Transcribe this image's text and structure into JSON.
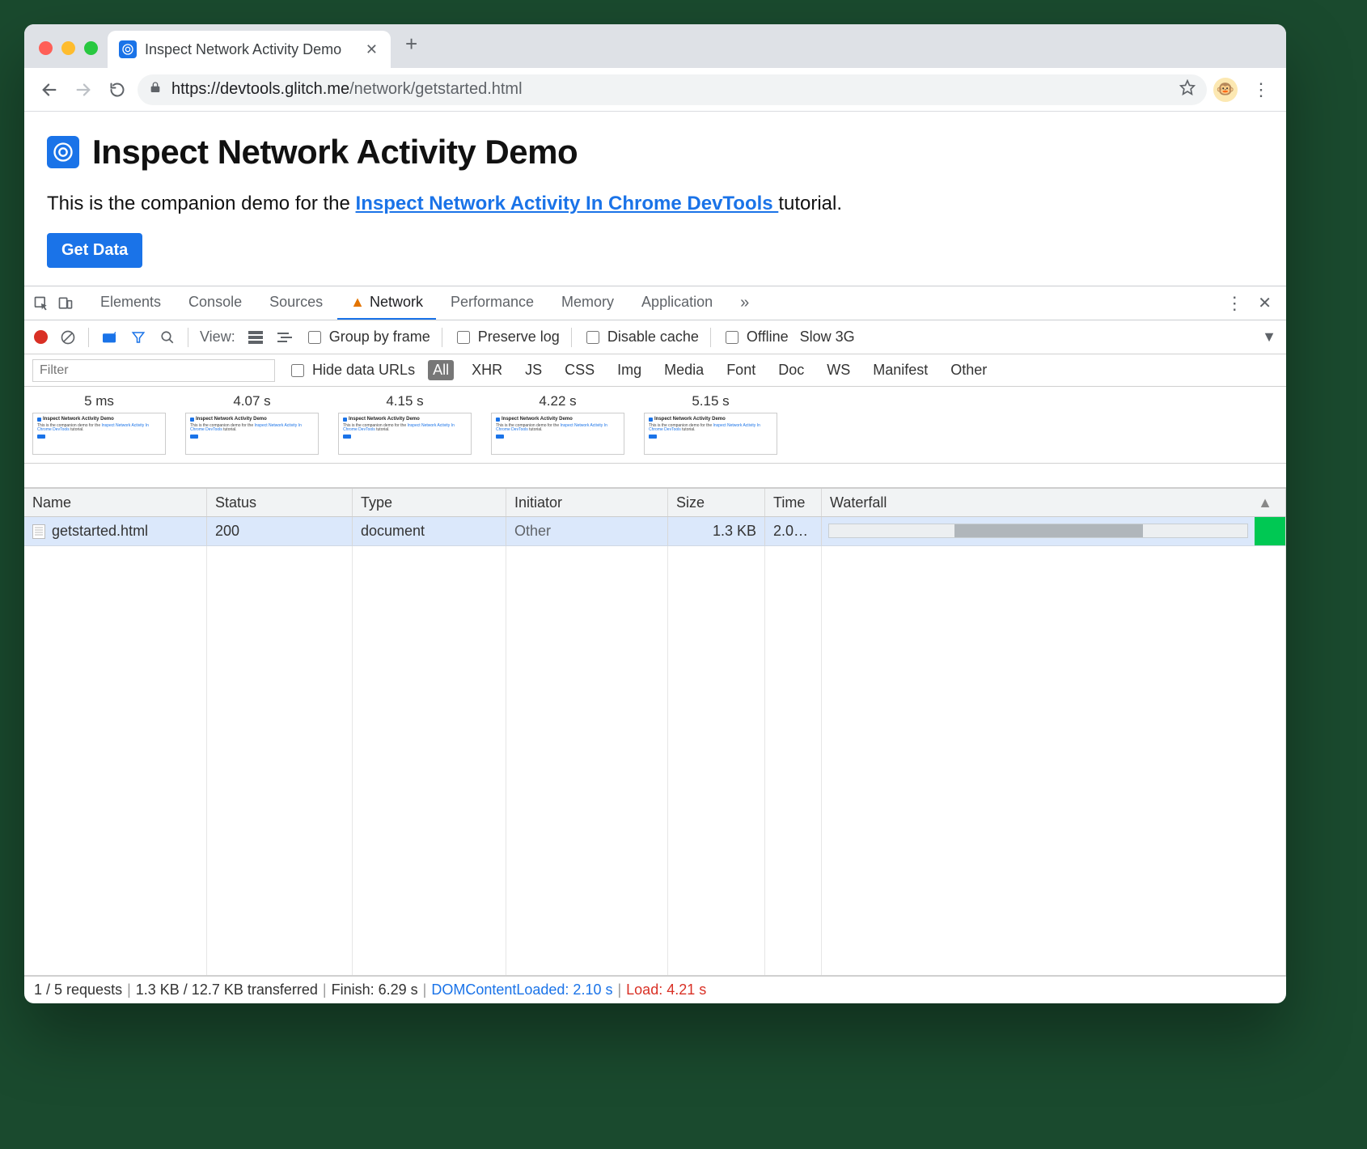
{
  "browser": {
    "tab_title": "Inspect Network Activity Demo",
    "url_display_host": "https://devtools.glitch.me",
    "url_display_path": "/network/getstarted.html"
  },
  "page": {
    "heading": "Inspect Network Activity Demo",
    "intro_before": "This is the companion demo for the ",
    "intro_link": "Inspect Network Activity In Chrome DevTools ",
    "intro_after": "tutorial.",
    "button_label": "Get Data"
  },
  "devtools": {
    "tabs": {
      "elements": "Elements",
      "console": "Console",
      "sources": "Sources",
      "network": "Network",
      "performance": "Performance",
      "memory": "Memory",
      "application": "Application"
    },
    "toolbar": {
      "view_label": "View:",
      "group_by_frame": "Group by frame",
      "preserve_log": "Preserve log",
      "disable_cache": "Disable cache",
      "offline": "Offline",
      "throttle": "Slow 3G"
    },
    "filterbar": {
      "placeholder": "Filter",
      "hide_data_urls": "Hide data URLs",
      "types": [
        "All",
        "XHR",
        "JS",
        "CSS",
        "Img",
        "Media",
        "Font",
        "Doc",
        "WS",
        "Manifest",
        "Other"
      ],
      "active_type": "All"
    },
    "filmstrip": [
      {
        "time": "5 ms"
      },
      {
        "time": "4.07 s"
      },
      {
        "time": "4.15 s"
      },
      {
        "time": "4.22 s"
      },
      {
        "time": "5.15 s"
      }
    ],
    "columns": {
      "name": "Name",
      "status": "Status",
      "type": "Type",
      "initiator": "Initiator",
      "size": "Size",
      "time": "Time",
      "waterfall": "Waterfall"
    },
    "requests": [
      {
        "name": "getstarted.html",
        "status": "200",
        "type": "document",
        "initiator": "Other",
        "size": "1.3 KB",
        "time": "2.0…"
      }
    ],
    "status": {
      "requests": "1 / 5 requests",
      "transferred": "1.3 KB / 12.7 KB transferred",
      "finish": "Finish: 6.29 s",
      "dcl": "DOMContentLoaded: 2.10 s",
      "load": "Load: 4.21 s"
    }
  }
}
